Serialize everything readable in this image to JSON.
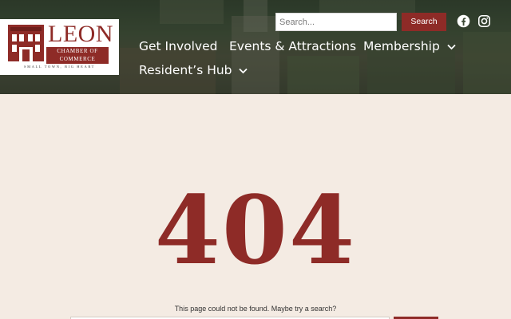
{
  "header": {
    "logo": {
      "wordmark": "LEON",
      "subtitle_line1": "CHAMBER OF",
      "subtitle_line2": "COMMERCE",
      "tagline": "SMALL TOWN, BIG HEART"
    },
    "search": {
      "placeholder": "Search...",
      "button_label": "Search"
    },
    "social": [
      {
        "icon": "facebook-icon"
      },
      {
        "icon": "instagram-icon"
      }
    ],
    "nav": [
      {
        "label": "Get Involved",
        "has_dropdown": false
      },
      {
        "label": "Events & Attractions",
        "has_dropdown": false
      },
      {
        "label": "Membership",
        "has_dropdown": true
      },
      {
        "label": "Resident’s Hub",
        "has_dropdown": true
      }
    ]
  },
  "main": {
    "error_code": "404",
    "message": "This page could not be found. Maybe try a search?"
  },
  "colors": {
    "brand": "#8e2b27",
    "page_background": "#f4ebe3",
    "header_overlay": "#3c4a35"
  }
}
